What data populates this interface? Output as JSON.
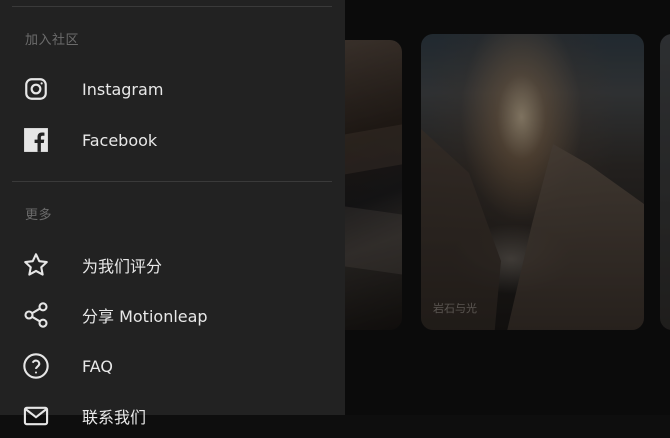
{
  "drawer": {
    "sections": [
      {
        "title": "加入社区",
        "items": [
          {
            "icon": "instagram-icon",
            "label": "Instagram"
          },
          {
            "icon": "facebook-icon",
            "label": "Facebook"
          }
        ]
      },
      {
        "title": "更多",
        "items": [
          {
            "icon": "star-icon",
            "label": "为我们评分"
          },
          {
            "icon": "share-icon",
            "label": "分享 Motionleap"
          },
          {
            "icon": "help-circle-icon",
            "label": "FAQ"
          },
          {
            "icon": "mail-icon",
            "label": "联系我们"
          }
        ]
      }
    ]
  },
  "background": {
    "main_card_caption": "岩石与光"
  }
}
